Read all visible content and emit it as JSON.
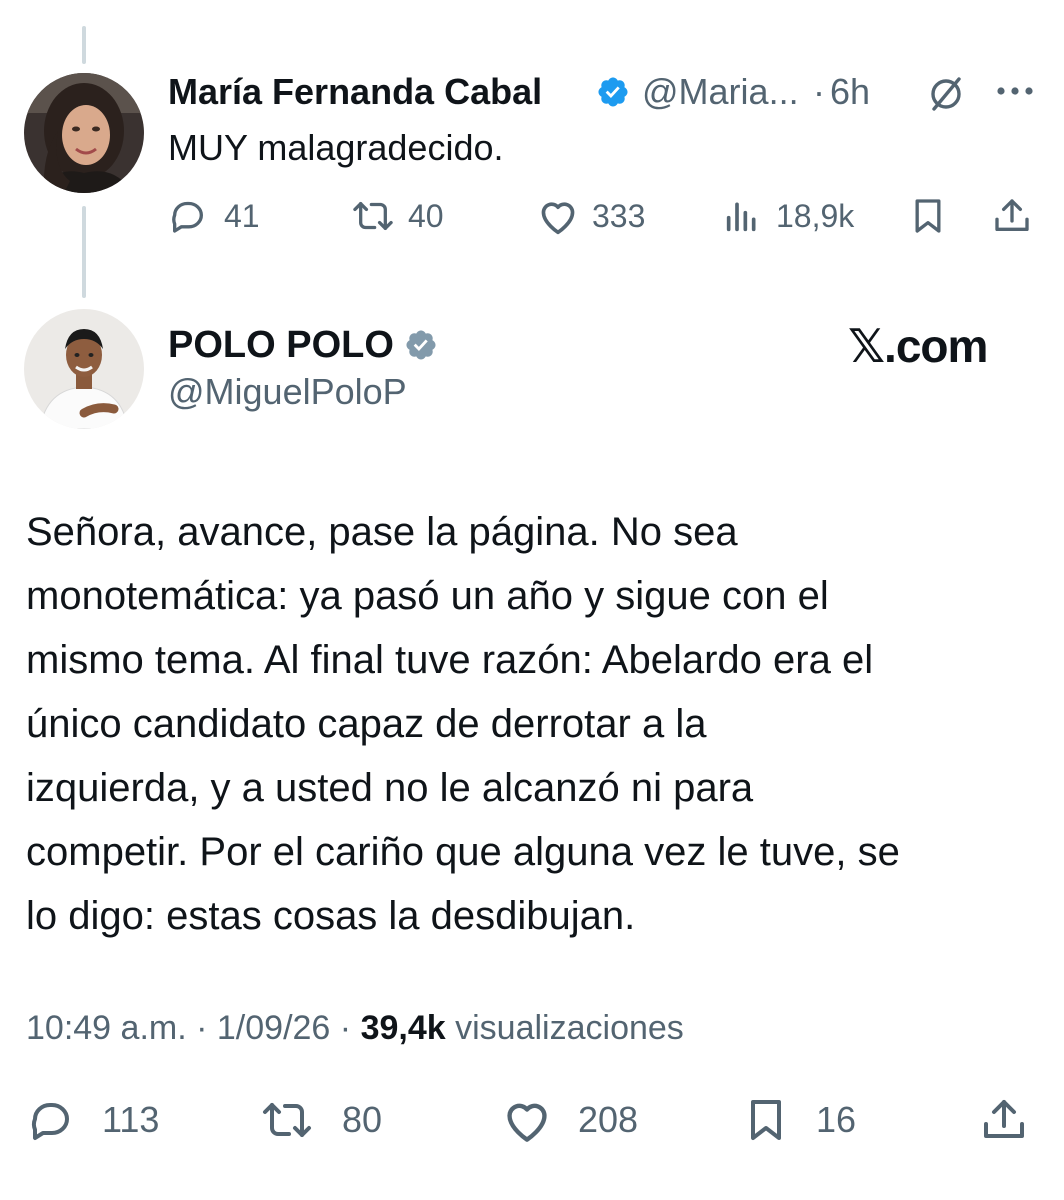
{
  "reply_context": {
    "author": {
      "name": "María Fernanda Cabal",
      "handle": "@Maria...",
      "separator": "·",
      "time": "6h",
      "verified_icon": "verified-blue-badge-icon",
      "verified_color": "#1d9bf0"
    },
    "text": "MUY malagradecido.",
    "more_icon": "ellipsis-icon",
    "grok_icon": "slashed-circle-icon",
    "stats": {
      "replies": "41",
      "reposts": "40",
      "likes": "333",
      "views": "18,9k"
    }
  },
  "main_tweet": {
    "author": {
      "name": "POLO POLO",
      "handle": "@MiguelPoloP",
      "verified_icon": "verified-gray-badge-icon",
      "verified_color": "#829aab"
    },
    "watermark": "𝕏.com",
    "text_lines": [
      "Señora, avance, pase la página. No sea",
      "monotemática: ya pasó un año y sigue con el",
      "mismo tema. Al final tuve razón: Abelardo era el",
      "único candidato capaz de derrotar a la",
      "izquierda, y a usted no le alcanzó ni para",
      "competir. Por el cariño que alguna vez le tuve, se",
      "lo digo: estas cosas la desdibujan."
    ],
    "meta": {
      "time": "10:49 a.m.",
      "sep1": "·",
      "date": "1/09/26",
      "sep2": "·",
      "views_count": "39,4k",
      "views_label": "visualizaciones"
    },
    "stats": {
      "replies": "113",
      "reposts": "80",
      "likes": "208",
      "bookmarks": "16"
    }
  },
  "colors": {
    "text": "#0f1419",
    "secondary": "#536471",
    "thread_line": "#cfd9de"
  }
}
